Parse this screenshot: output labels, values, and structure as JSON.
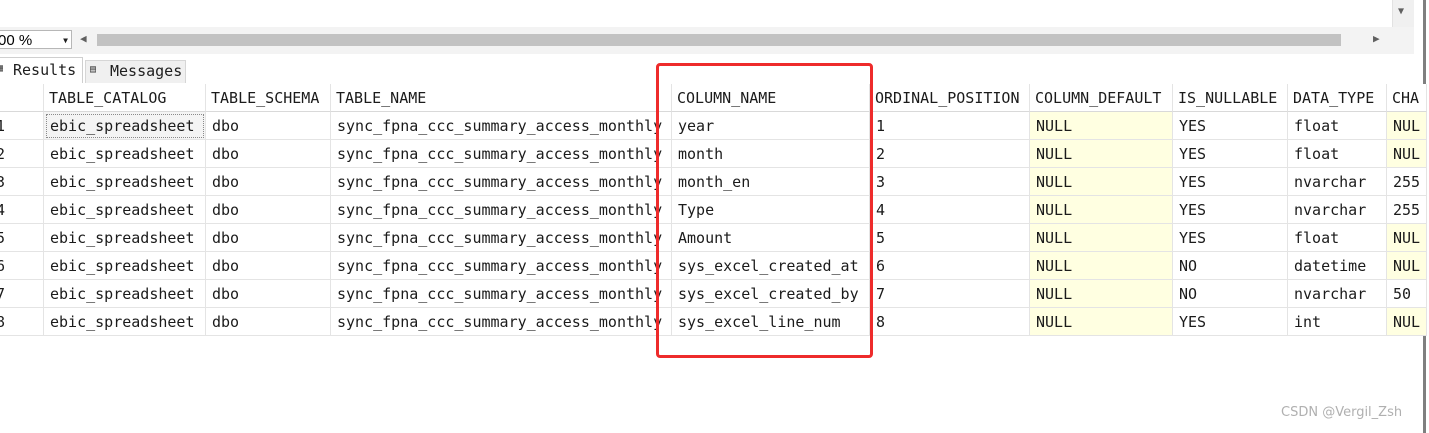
{
  "toolbar": {
    "zoom_value": "00 %",
    "zoom_dropdown_icon": "dropdown-arrow-icon",
    "scroll_left_icon": "chevron-left-icon",
    "scroll_right_icon": "chevron-right-icon"
  },
  "tabs": [
    {
      "label": "Results",
      "icon": "grid-icon",
      "active": true
    },
    {
      "label": "Messages",
      "icon": "messages-icon",
      "active": false
    }
  ],
  "grid": {
    "columns": [
      "TABLE_CATALOG",
      "TABLE_SCHEMA",
      "TABLE_NAME",
      "COLUMN_NAME",
      "ORDINAL_POSITION",
      "COLUMN_DEFAULT",
      "IS_NULLABLE",
      "DATA_TYPE",
      "CHA"
    ],
    "rows": [
      {
        "num": "1",
        "cells": [
          "ebic_spreadsheet",
          "dbo",
          "sync_fpna_ccc_summary_access_monthly",
          "year",
          "1",
          "NULL",
          "YES",
          "float",
          "NUL"
        ]
      },
      {
        "num": "2",
        "cells": [
          "ebic_spreadsheet",
          "dbo",
          "sync_fpna_ccc_summary_access_monthly",
          "month",
          "2",
          "NULL",
          "YES",
          "float",
          "NUL"
        ]
      },
      {
        "num": "3",
        "cells": [
          "ebic_spreadsheet",
          "dbo",
          "sync_fpna_ccc_summary_access_monthly",
          "month_en",
          "3",
          "NULL",
          "YES",
          "nvarchar",
          "255"
        ]
      },
      {
        "num": "4",
        "cells": [
          "ebic_spreadsheet",
          "dbo",
          "sync_fpna_ccc_summary_access_monthly",
          "Type",
          "4",
          "NULL",
          "YES",
          "nvarchar",
          "255"
        ]
      },
      {
        "num": "5",
        "cells": [
          "ebic_spreadsheet",
          "dbo",
          "sync_fpna_ccc_summary_access_monthly",
          "Amount",
          "5",
          "NULL",
          "YES",
          "float",
          "NUL"
        ]
      },
      {
        "num": "6",
        "cells": [
          "ebic_spreadsheet",
          "dbo",
          "sync_fpna_ccc_summary_access_monthly",
          "sys_excel_created_at",
          "6",
          "NULL",
          "NO",
          "datetime",
          "NUL"
        ]
      },
      {
        "num": "7",
        "cells": [
          "ebic_spreadsheet",
          "dbo",
          "sync_fpna_ccc_summary_access_monthly",
          "sys_excel_created_by",
          "7",
          "NULL",
          "NO",
          "nvarchar",
          "50"
        ]
      },
      {
        "num": "8",
        "cells": [
          "ebic_spreadsheet",
          "dbo",
          "sync_fpna_ccc_summary_access_monthly",
          "sys_excel_line_num",
          "8",
          "NULL",
          "YES",
          "int",
          "NUL"
        ]
      }
    ]
  },
  "watermark": "CSDN @Vergil_Zsh",
  "colors": {
    "highlight_box": "#ee2b2b",
    "null_cell_bg": "#ffffe1",
    "grid_line": "#e4e4e4"
  }
}
